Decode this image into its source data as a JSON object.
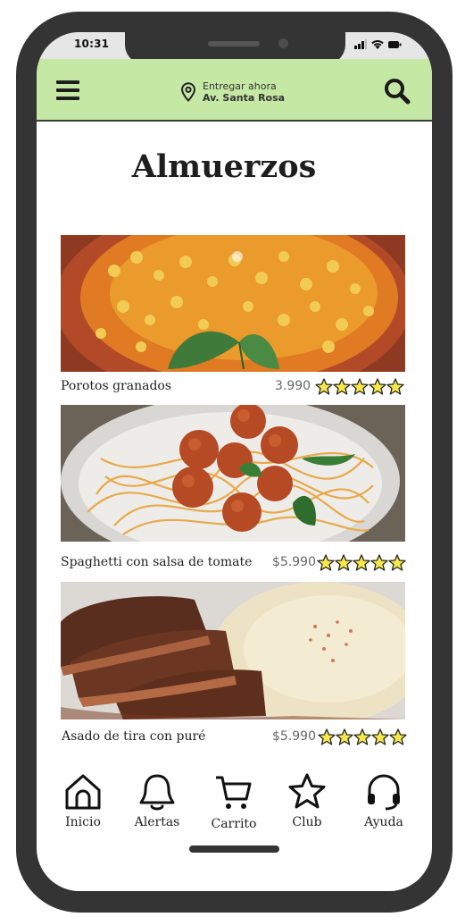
{
  "status_bar": {
    "time": "10:31"
  },
  "header": {
    "menu_icon": "hamburger-menu-icon",
    "location_icon": "map-pin-icon",
    "location_label": "Entregar ahora",
    "location_value": "Av. Santa Rosa",
    "search_icon": "search-icon",
    "background_color": "#c6e8a5"
  },
  "page_title": "Almuerzos",
  "foods": [
    {
      "name": "Porotos granados",
      "price": "3.990",
      "rating": 5
    },
    {
      "name": "Spaghetti con salsa de tomate",
      "price": "$5.990",
      "rating": 5
    },
    {
      "name": "Asado de tira con puré",
      "price": "$5.990",
      "rating": 5
    }
  ],
  "star_color": "#f5e84a",
  "bottom_nav": [
    {
      "label": "Inicio",
      "icon": "home-icon"
    },
    {
      "label": "Alertas",
      "icon": "bell-icon"
    },
    {
      "label": "Carrito",
      "icon": "cart-icon"
    },
    {
      "label": "Club",
      "icon": "star-icon"
    },
    {
      "label": "Ayuda",
      "icon": "headset-icon"
    }
  ]
}
